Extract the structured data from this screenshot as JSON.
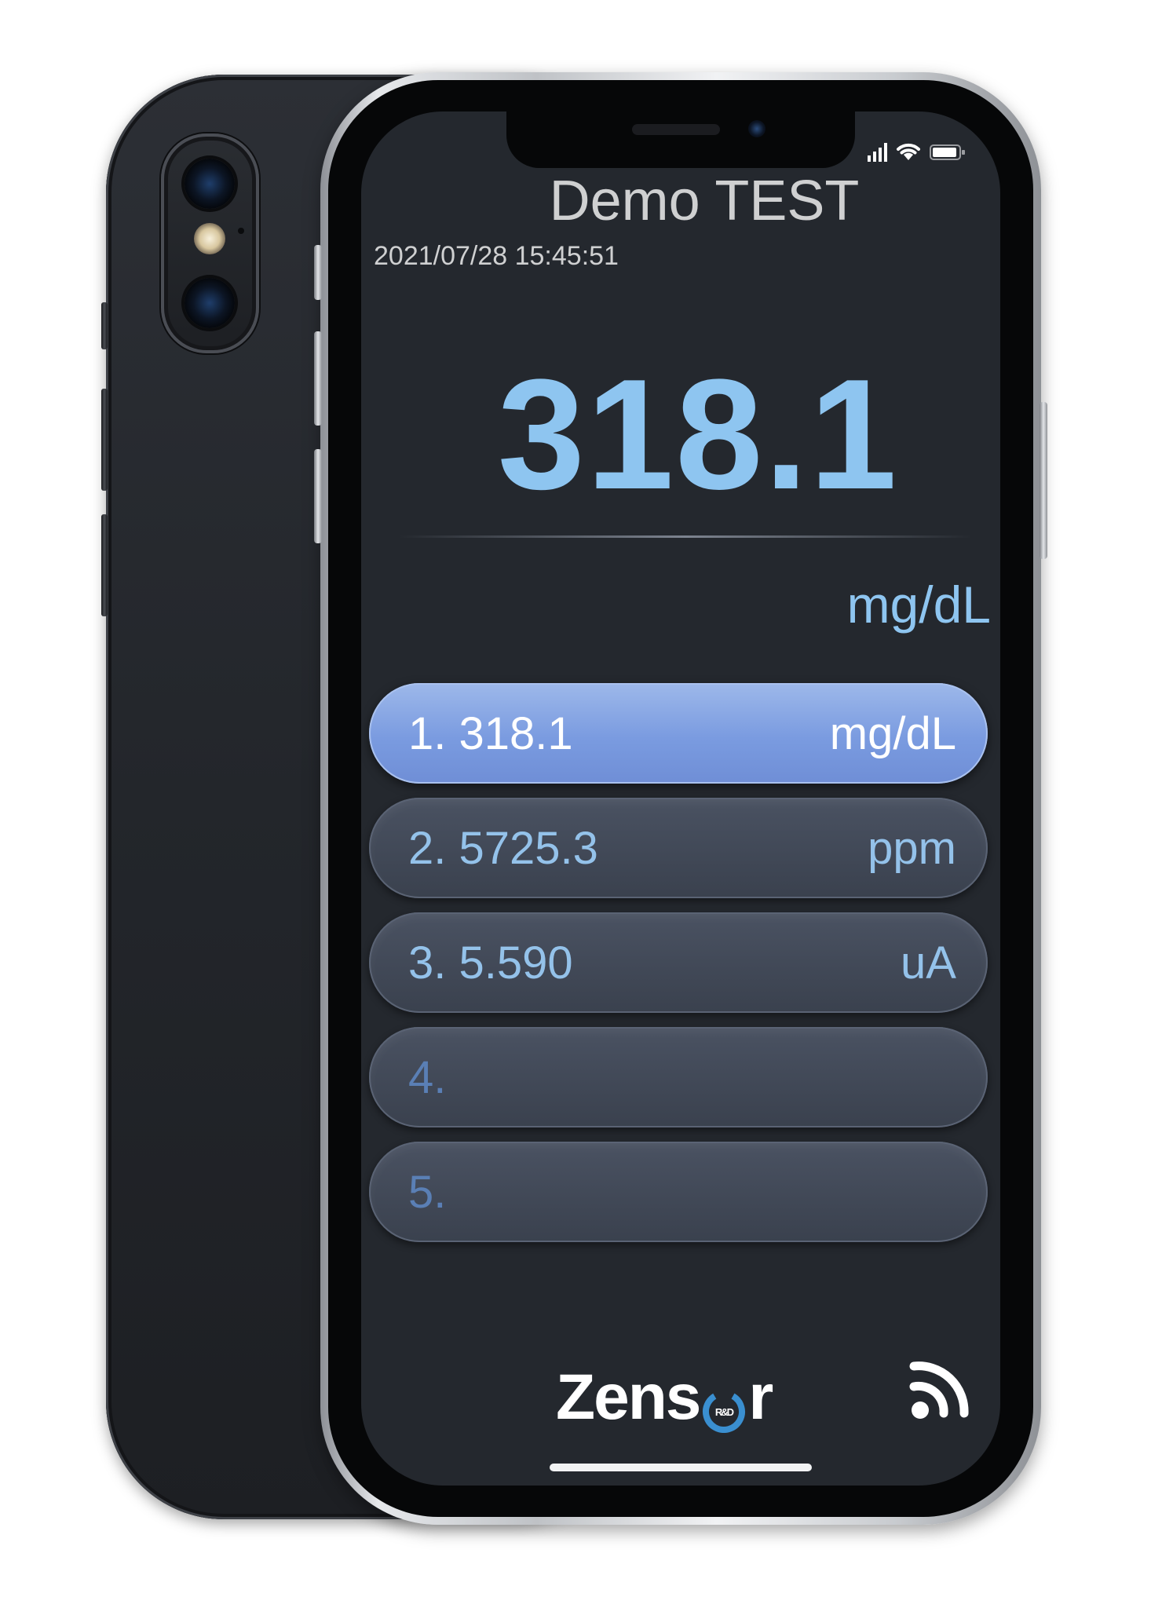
{
  "app": {
    "title": "Demo TEST",
    "timestamp": "2021/07/28 15:45:51"
  },
  "main_reading": {
    "value": "318.1",
    "unit": "mg/dL"
  },
  "readings": [
    {
      "index": "1.",
      "value": "318.1",
      "unit": "mg/dL",
      "active": true
    },
    {
      "index": "2.",
      "value": "5725.3",
      "unit": "ppm",
      "active": false
    },
    {
      "index": "3.",
      "value": "5.590",
      "unit": "uA",
      "active": false
    },
    {
      "index": "4.",
      "value": "",
      "unit": "",
      "active": false
    },
    {
      "index": "5.",
      "value": "",
      "unit": "",
      "active": false
    }
  ],
  "footer": {
    "brand_left": "Zens",
    "brand_right": "r",
    "brand_badge": "R&D",
    "wifi_icon": "wifi-icon"
  },
  "status_bar": {
    "icons": [
      "signal-icon",
      "wifi-icon",
      "battery-icon"
    ]
  },
  "colors": {
    "accent": "#8ec5f0",
    "active_row": "#7a9be0",
    "background": "#24282e"
  }
}
